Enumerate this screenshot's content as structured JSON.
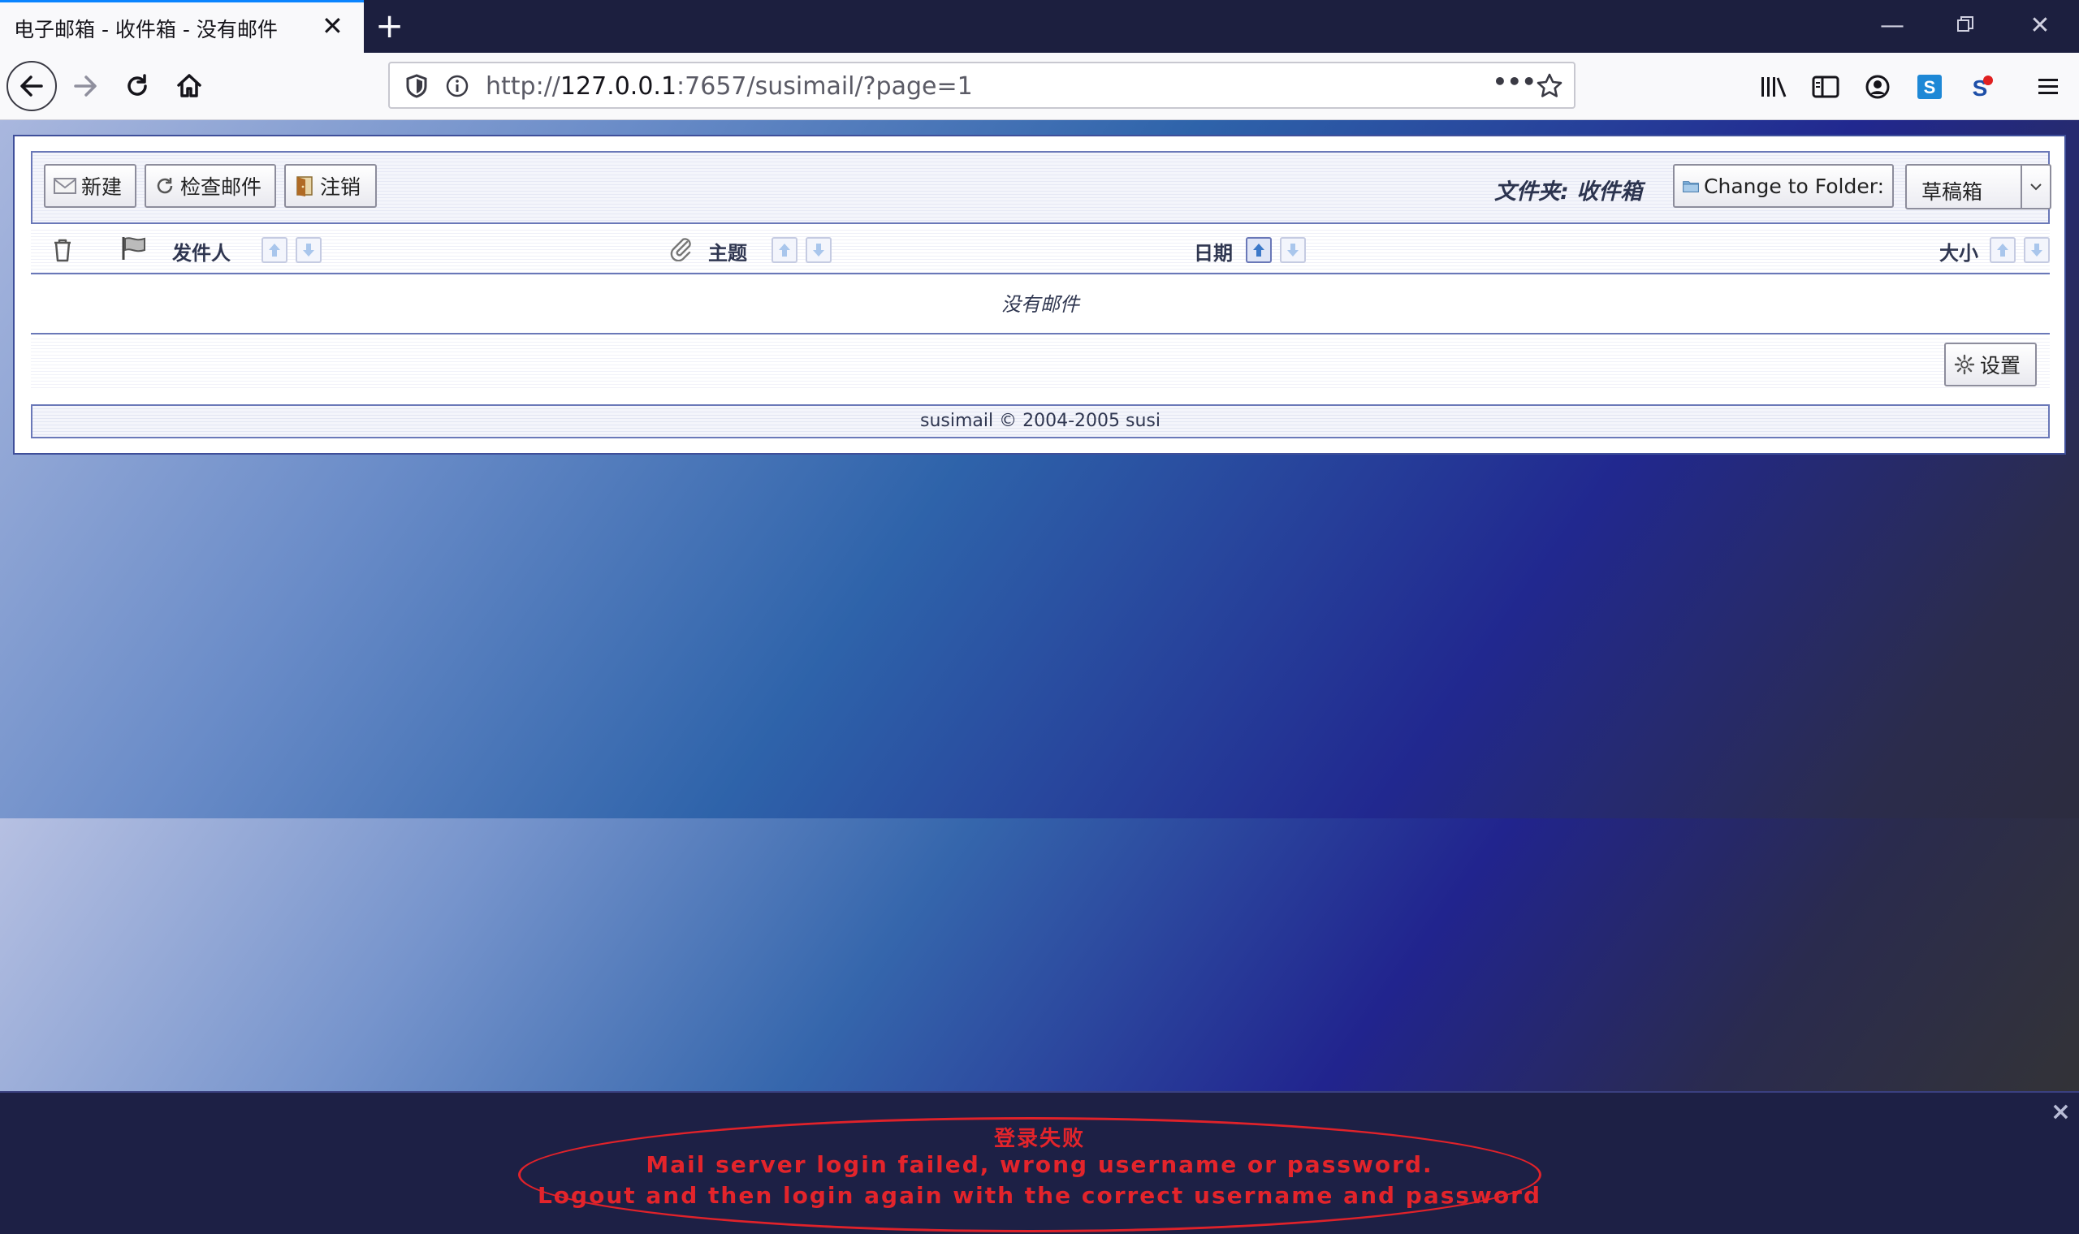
{
  "browser": {
    "tab_title": "电子邮箱 - 收件箱 - 没有邮件",
    "url_prefix": "http://",
    "url_host": "127.0.0.1",
    "url_rest": ":7657/susimail/?page=1",
    "url_more": "•••"
  },
  "toolbar": {
    "new_label": "新建",
    "check_label": "检查邮件",
    "logout_label": "注销",
    "folder_label": "文件夹: 收件箱",
    "change_folder_label": "Change to Folder:",
    "folder_select_value": "草稿箱"
  },
  "columns": {
    "sender": "发件人",
    "subject": "主题",
    "date": "日期",
    "size": "大小"
  },
  "empty_message": "没有邮件",
  "settings_label": "设置",
  "footer_text": "susimail © 2004-2005 susi",
  "notice": {
    "title": "登录失败",
    "line1": "Mail server login failed, wrong username or password.",
    "line2": "Logout and then login again with the correct username and password",
    "close": "×"
  },
  "colors": {
    "accent": "#0a84ff",
    "error": "#e3242b",
    "border": "#6a78b8"
  }
}
